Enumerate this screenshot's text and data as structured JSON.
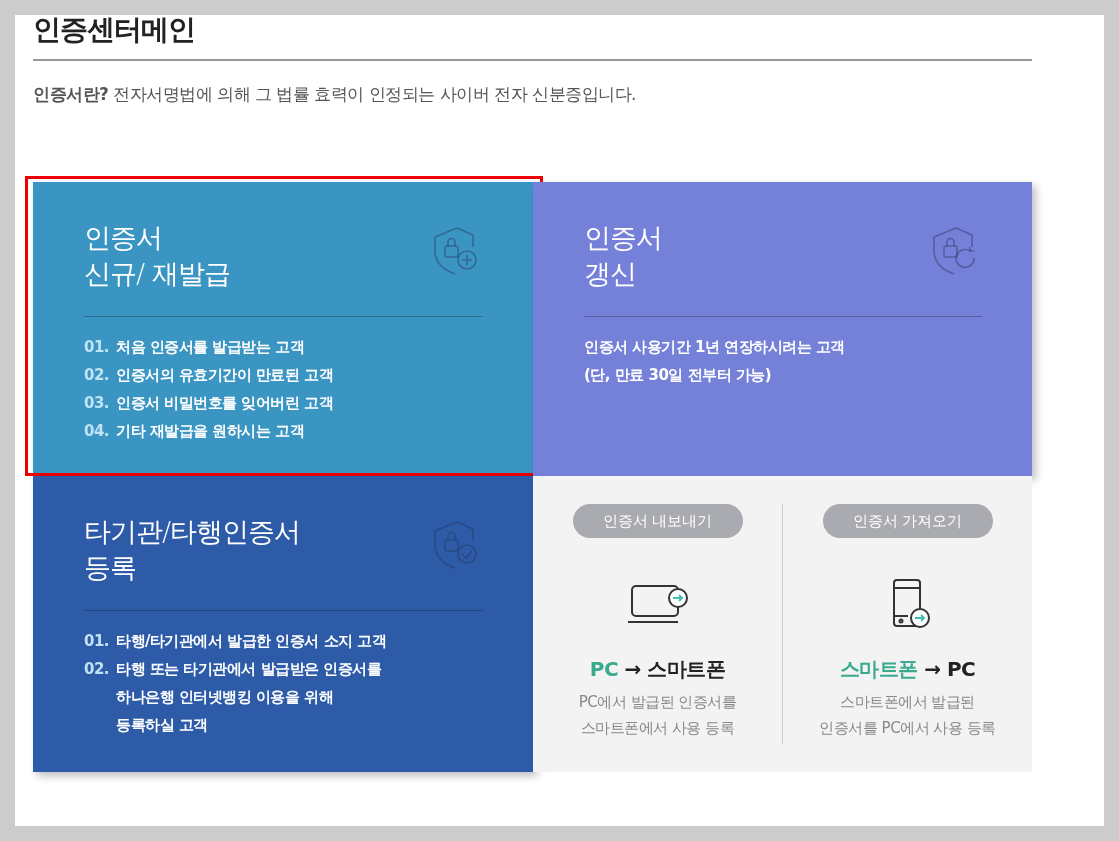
{
  "page_title": "인증센터메인",
  "intro": "**인증서란?** 전자서명법에 의해 그 법률 효력이 인정되는 사이버 전자 신분증입니다.",
  "cards": [
    {
      "kind": "info",
      "color": "#3b95c3",
      "highlighted": true,
      "title_lines": [
        "인증서",
        "신규/ 재발급"
      ],
      "items": [
        {
          "number": "01.",
          "lines": [
            "처음 인증서를 발급받는 고객"
          ]
        },
        {
          "number": "02.",
          "lines": [
            "인증서의 유효기간이 만료된 고객"
          ]
        },
        {
          "number": "03.",
          "lines": [
            "인증서 비밀번호를 잊어버린 고객"
          ]
        },
        {
          "number": "04.",
          "lines": [
            "기타 재발급을 원하시는 고객"
          ]
        }
      ]
    },
    {
      "kind": "info",
      "color": "#7581d9",
      "highlighted": false,
      "title_lines": [
        "인증서",
        "갱신"
      ],
      "items": [
        {
          "lines": [
            "인증서 사용기간 1년 연장하시려는 고객"
          ]
        },
        {
          "lines": [
            "(단, 만료 30일 전부터 가능)"
          ]
        }
      ]
    },
    {
      "kind": "info",
      "color": "#2d5ba8",
      "highlighted": false,
      "title_lines": [
        "타기관/타행인증서",
        "등록"
      ],
      "items": [
        {
          "number": "01.",
          "lines": [
            "타행/타기관에서 발급한 인증서 소지 고객"
          ]
        },
        {
          "number": "02.",
          "lines": [
            "타행 또는 타기관에서 발급받은 인증서를",
            "하나은행 인터넷뱅킹 이용을 위해",
            "등록하실 고객"
          ]
        }
      ]
    },
    {
      "kind": "transfer",
      "color": "#f3f3f3",
      "highlighted": false,
      "options": [
        {
          "button": "인증서 내보내기",
          "from": "PC",
          "arrow": "→",
          "to": "스마트폰",
          "desc_lines": [
            "PC에서 발급된 인증서를",
            "스마트폰에서 사용 등록"
          ]
        },
        {
          "button": "인증서 가져오기",
          "from": "스마트폰",
          "arrow": "→",
          "to": "PC",
          "desc_lines": [
            "스마트폰에서 발급된",
            "인증서를 PC에서 사용 등록"
          ]
        }
      ]
    }
  ]
}
